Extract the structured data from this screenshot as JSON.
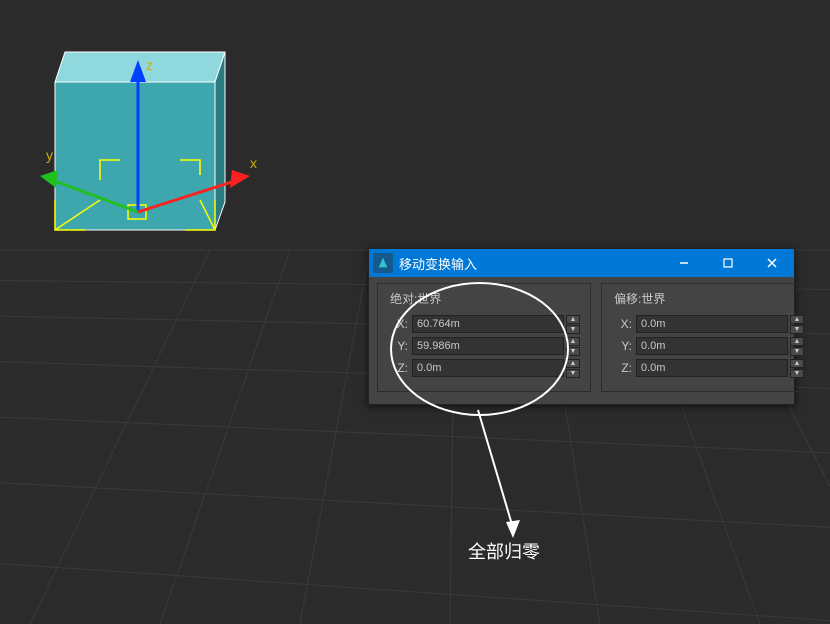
{
  "viewport": {
    "axes": {
      "x_label": "x",
      "y_label": "y",
      "z_label": "z"
    }
  },
  "dialog": {
    "title": "移动变换输入",
    "groups": {
      "absolute": {
        "title": "绝对:世界",
        "x_label": "X:",
        "y_label": "Y:",
        "z_label": "Z:",
        "x_value": "60.764m",
        "y_value": "59.986m",
        "z_value": "0.0m"
      },
      "offset": {
        "title": "偏移:世界",
        "x_label": "X:",
        "y_label": "Y:",
        "z_label": "Z:",
        "x_value": "0.0m",
        "y_value": "0.0m",
        "z_value": "0.0m"
      }
    }
  },
  "annotation": {
    "text": "全部归零"
  }
}
